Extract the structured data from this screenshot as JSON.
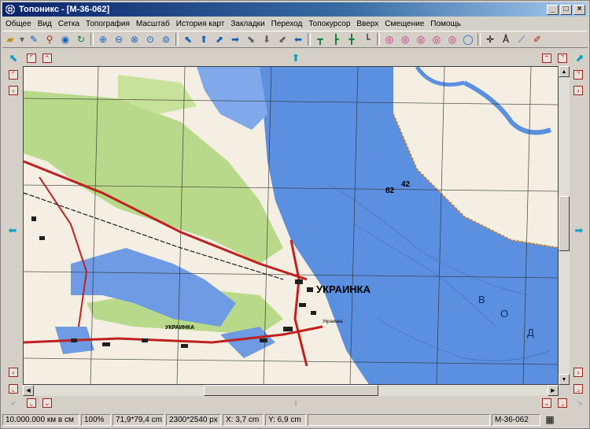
{
  "window": {
    "title": "Топоникс - [M-36-062]"
  },
  "menu": [
    "Общее",
    "Вид",
    "Сетка",
    "Топография",
    "Масштаб",
    "История карт",
    "Закладки",
    "Переход",
    "Топокурсор",
    "Вверх",
    "Смещение",
    "Помощь"
  ],
  "map": {
    "town_label": "УКРАИНКА",
    "town_label_small": "УКРАИНКА",
    "water_letters": [
      "В",
      "О",
      "Д"
    ],
    "elevations": [
      "82",
      "42"
    ],
    "village_label": "Украинка"
  },
  "status": {
    "scale": "10.000.000 км в см",
    "zoom": "100%",
    "size_cm": "71,9*79,4 cm",
    "size_px": "2300*2540 px",
    "x": "X: 3,7 cm",
    "y": "Y: 6,9 cm",
    "sheet": "M-36-062"
  },
  "colors": {
    "water": "#5b8fe0",
    "forest": "#b9d98a",
    "title_start": "#0a246a"
  }
}
